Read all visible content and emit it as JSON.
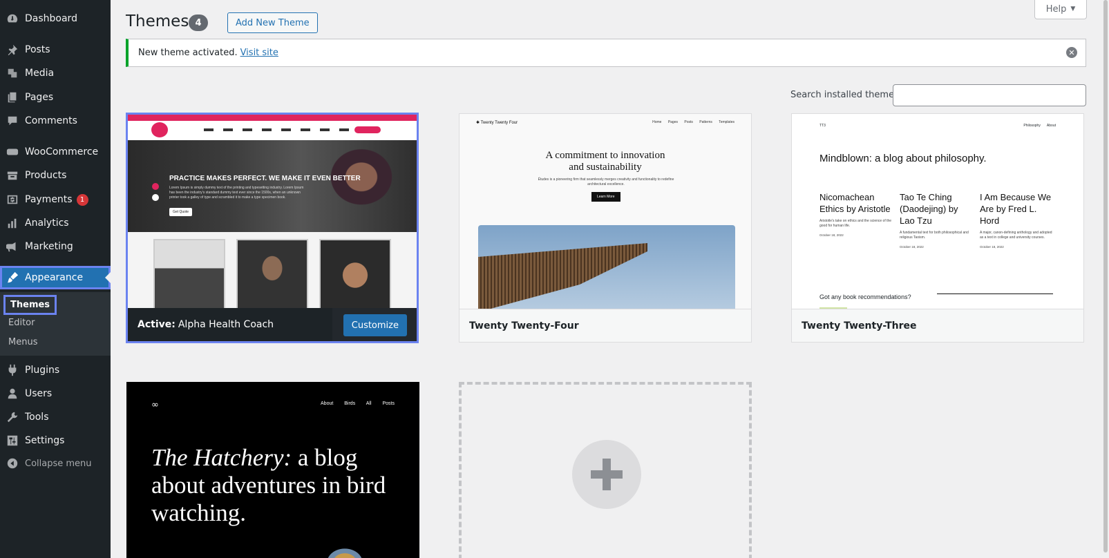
{
  "sidebar": {
    "items": [
      {
        "label": "Dashboard",
        "icon": "dashboard-icon"
      },
      {
        "label": "Posts",
        "icon": "pin-icon"
      },
      {
        "label": "Media",
        "icon": "media-icon"
      },
      {
        "label": "Pages",
        "icon": "pages-icon"
      },
      {
        "label": "Comments",
        "icon": "comment-icon"
      },
      {
        "label": "WooCommerce",
        "icon": "woo-icon"
      },
      {
        "label": "Products",
        "icon": "archive-icon"
      },
      {
        "label": "Payments",
        "icon": "money-icon",
        "badge": "1"
      },
      {
        "label": "Analytics",
        "icon": "bar-chart-icon"
      },
      {
        "label": "Marketing",
        "icon": "megaphone-icon"
      },
      {
        "label": "Appearance",
        "icon": "brush-icon"
      },
      {
        "label": "Plugins",
        "icon": "plug-icon"
      },
      {
        "label": "Users",
        "icon": "user-icon"
      },
      {
        "label": "Tools",
        "icon": "wrench-icon"
      },
      {
        "label": "Settings",
        "icon": "sliders-icon"
      }
    ],
    "submenu": [
      "Themes",
      "Editor",
      "Menus"
    ],
    "collapse_label": "Collapse menu"
  },
  "header": {
    "title": "Themes",
    "count": "4",
    "add_new": "Add New Theme",
    "help": "Help"
  },
  "notice": {
    "text": "New theme activated.",
    "link": "Visit site"
  },
  "search": {
    "label": "Search installed themes",
    "value": ""
  },
  "themes": {
    "active": {
      "prefix": "Active:",
      "name": "Alpha Health Coach",
      "customize": "Customize",
      "shot_title": "PRACTICE MAKES PERFECT. WE MAKE IT EVEN BETTER",
      "shot_text": "Lorem Ipsum is simply dummy text of the printing and typesetting industry. Lorem Ipsum has been the industry's standard dummy text ever since the 1500s, when an unknown printer took a galley of type and scrambled it to make a type specimen book.",
      "shot_button": "Get Quote"
    },
    "tt4": {
      "name": "Twenty Twenty-Four",
      "logo": "Twenty Twenty Four",
      "menu": "Home Pages Posts Patterns Templates",
      "headline_1": "A commitment to innovation",
      "headline_2": "and sustainability",
      "sub": "Études is a pioneering firm that seamlessly merges creativity and functionality to redefine architectural excellence.",
      "button": "Learn More"
    },
    "tt3": {
      "name": "Twenty Twenty-Three",
      "logo": "TT3",
      "menu": "Philosophy About",
      "headline": "Mindblown: a blog about philosophy.",
      "cols": [
        {
          "title": "Nicomachean Ethics by Aristotle",
          "desc": "Aristotle's take on ethics and the science of the good for human life.",
          "date": "October 18, 2022"
        },
        {
          "title": "Tao Te Ching (Daodejing) by Lao Tzu",
          "desc": "A fundamental text for both philosophical and religious Taoism.",
          "date": "October 18, 2022"
        },
        {
          "title": "I Am Because We Are by Fred L. Hord",
          "desc": "A major, canon-defining anthology and adopted as a text in college and university courses.",
          "date": "October 18, 2022"
        }
      ],
      "footer": "Got any book recommendations?"
    },
    "hatchery": {
      "menu": "About Birds All Posts",
      "headline_italic": "The Hatchery:",
      "headline_rest": " a blog about adventures in bird watching."
    }
  },
  "colors": {
    "accent": "#2271b1",
    "sidebar_bg": "#1d2327",
    "highlight": "#6b83f0",
    "success": "#00a32a",
    "badge": "#d63638"
  }
}
